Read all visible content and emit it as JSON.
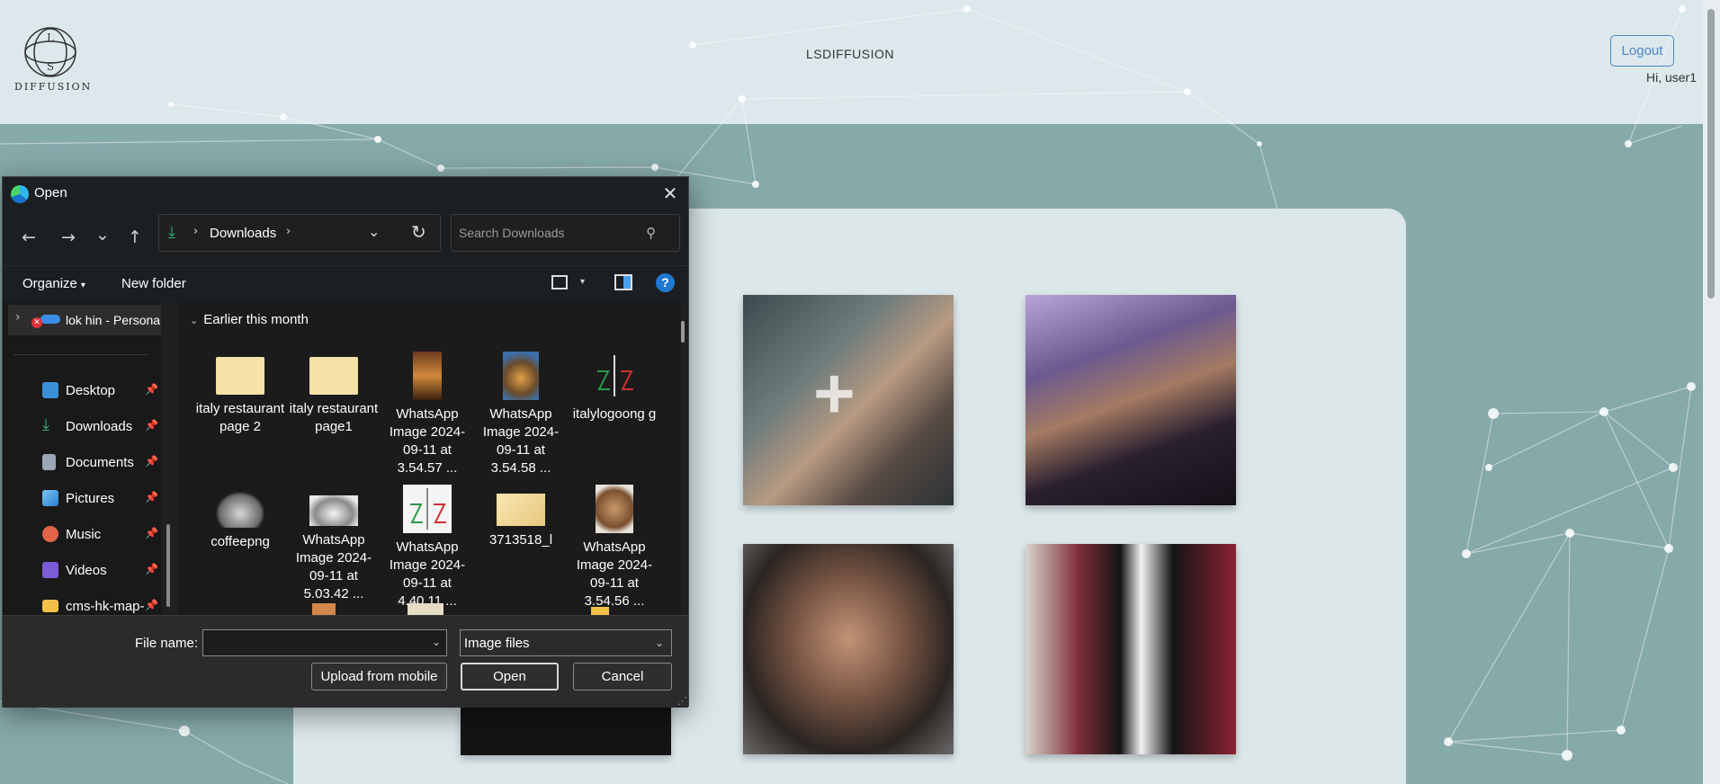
{
  "site": {
    "logo_text": "DIFFUSION",
    "logo_letters": [
      "L",
      "S"
    ],
    "title": "LSDIFFUSION",
    "logout_label": "Logout",
    "greeting": "Hi, user1",
    "upload_plus_symbol": "+"
  },
  "dialog": {
    "title": "Open",
    "close_symbol": "✕",
    "nav": {
      "back_symbol": "←",
      "forward_symbol": "→",
      "recent_symbol": "⌄",
      "up_symbol": "↑",
      "address_icon": "download-icon",
      "address_sep1": "›",
      "address_text": "Downloads",
      "address_sep2": "›",
      "address_drop": "⌄",
      "refresh_symbol": "↻",
      "search_placeholder": "Search Downloads",
      "search_symbol": "⚲"
    },
    "commands": {
      "organize": "Organize",
      "organize_caret": "▾",
      "new_folder": "New folder",
      "view_caret": "▾",
      "help_symbol": "?"
    },
    "sidebar": {
      "onedrive_chevron": "›",
      "onedrive_error": "✕",
      "onedrive_label": "lok hin - Persona",
      "pin_symbol": "📌",
      "items": [
        {
          "label": "Desktop",
          "icon": "desktop-icon",
          "color": "#3b8fd9",
          "pinned": true
        },
        {
          "label": "Downloads",
          "icon": "download-icon",
          "color": "#35b37a",
          "pinned": true
        },
        {
          "label": "Documents",
          "icon": "document-icon",
          "color": "#9aa7b5",
          "pinned": true
        },
        {
          "label": "Pictures",
          "icon": "pictures-icon",
          "color": "#3b9be0",
          "pinned": true
        },
        {
          "label": "Music",
          "icon": "music-icon",
          "color": "#e0644a",
          "pinned": true
        },
        {
          "label": "Videos",
          "icon": "videos-icon",
          "color": "#7b5bd6",
          "pinned": true
        },
        {
          "label": "cms-hk-map-",
          "icon": "folder-icon",
          "color": "#f2c14a",
          "pinned": true
        }
      ]
    },
    "group": {
      "chevron": "⌄",
      "label": "Earlier this month"
    },
    "files": [
      {
        "label": "italy restaurant page 2",
        "kind": "menu"
      },
      {
        "label": "italy restaurant page1",
        "kind": "menu"
      },
      {
        "label": "WhatsApp Image 2024-09-11 at 3.54.57 ...",
        "kind": "photo-dark"
      },
      {
        "label": "WhatsApp Image 2024-09-11 at 3.54.58 ...",
        "kind": "photo-food"
      },
      {
        "label": "italylogoong g",
        "kind": "logo"
      },
      {
        "label": "coffeepng",
        "kind": "coffee"
      },
      {
        "label": "WhatsApp Image 2024-09-11 at 5.03.42 ...",
        "kind": "coffee-light"
      },
      {
        "label": "WhatsApp Image 2024-09-11 at 4.40.11 ...",
        "kind": "logo-white"
      },
      {
        "label": "3713518_l",
        "kind": "paper"
      },
      {
        "label": "WhatsApp Image 2024-09-11 at 3.54.56 ...",
        "kind": "bread"
      }
    ],
    "footer": {
      "file_name_label": "File name:",
      "file_name_value": "",
      "dropdown_symbol": "⌄",
      "file_type": "Image files",
      "upload_mobile": "Upload from mobile",
      "open": "Open",
      "cancel": "Cancel",
      "grip_symbol": "⋰"
    }
  }
}
